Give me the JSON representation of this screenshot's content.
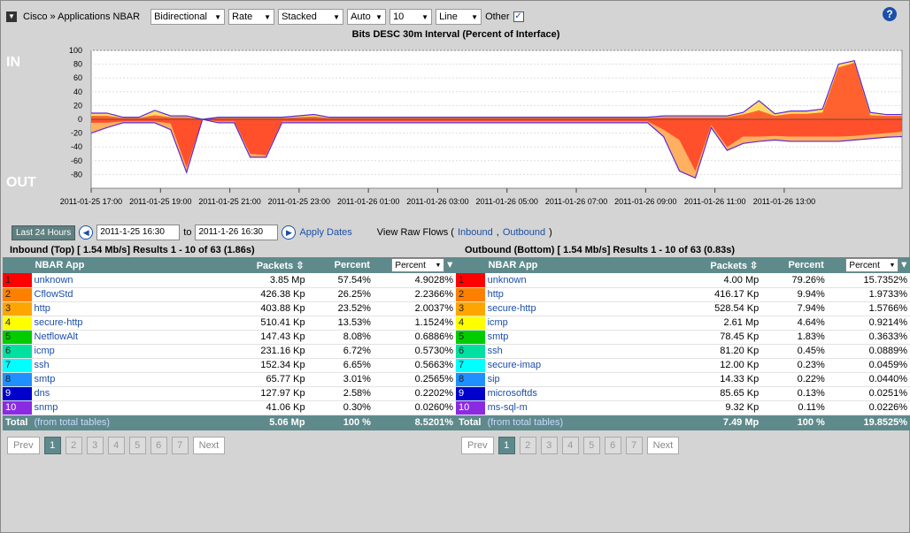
{
  "toolbar": {
    "title": "Cisco » Applications NBAR",
    "direction": "Bidirectional",
    "metric": "Rate",
    "style": "Stacked",
    "scale": "Auto",
    "top_n": "10",
    "chart_kind": "Line",
    "other_label": "Other",
    "other_checked": "✓"
  },
  "colors": {
    "series": [
      "#ff0000",
      "#ff7f00",
      "#ffa500",
      "#ffff00",
      "#00cc00",
      "#00e0a0",
      "#00ffff",
      "#1e90ff",
      "#0000cc",
      "#8a2be2"
    ]
  },
  "chart_data": {
    "type": "area",
    "title": "Bits DESC 30m Interval (Percent of Interface)",
    "in_label": "IN",
    "out_label": "OUT",
    "ylim": [
      -100,
      100
    ],
    "yticks": [
      "100",
      "80",
      "60",
      "40",
      "20",
      "0",
      "-20",
      "-40",
      "-60",
      "-80"
    ],
    "xticks": [
      "2011-01-25 17:00",
      "2011-01-25 19:00",
      "2011-01-25 21:00",
      "2011-01-25 23:00",
      "2011-01-26 01:00",
      "2011-01-26 03:00",
      "2011-01-26 05:00",
      "2011-01-26 07:00",
      "2011-01-26 09:00",
      "2011-01-26 11:00",
      "2011-01-26 13:00"
    ],
    "x": [
      0,
      1,
      2,
      3,
      4,
      5,
      6,
      7,
      8,
      9,
      10,
      11,
      12,
      13,
      14,
      15,
      16,
      17,
      18,
      19,
      20,
      21,
      22,
      23,
      24,
      25,
      26,
      27,
      28,
      29,
      30,
      31,
      32,
      33,
      34,
      35,
      36,
      37,
      38,
      39,
      40,
      41,
      42,
      43,
      44,
      45,
      46,
      47,
      48,
      49,
      50,
      51
    ],
    "inbound_total": [
      9,
      9,
      3,
      3,
      13,
      5,
      5,
      0,
      3,
      3,
      3,
      3,
      3,
      5,
      7,
      3,
      3,
      3,
      3,
      3,
      3,
      3,
      3,
      3,
      3,
      3,
      3,
      3,
      3,
      3,
      3,
      3,
      3,
      3,
      3,
      3,
      5,
      5,
      5,
      5,
      5,
      10,
      27,
      8,
      12,
      12,
      15,
      80,
      85,
      10,
      7,
      7
    ],
    "inbound_top": [
      5,
      5,
      2,
      2,
      6,
      3,
      3,
      0,
      2,
      2,
      2,
      2,
      2,
      3,
      4,
      2,
      2,
      2,
      2,
      2,
      2,
      2,
      2,
      2,
      2,
      2,
      2,
      2,
      2,
      2,
      2,
      2,
      2,
      2,
      2,
      2,
      3,
      3,
      3,
      3,
      3,
      7,
      13,
      5,
      8,
      8,
      10,
      75,
      82,
      6,
      5,
      5
    ],
    "outbound_total": [
      -20,
      -12,
      -5,
      -5,
      -5,
      -15,
      -77,
      0,
      -5,
      -5,
      -55,
      -55,
      -5,
      -5,
      -5,
      -5,
      -5,
      -5,
      -5,
      -5,
      -5,
      -5,
      -5,
      -5,
      -5,
      -5,
      -5,
      -5,
      -5,
      -5,
      -5,
      -5,
      -5,
      -5,
      -5,
      -5,
      -25,
      -75,
      -85,
      -12,
      -45,
      -35,
      -32,
      -30,
      -32,
      -32,
      -32,
      -32,
      -30,
      -28,
      -26,
      -25
    ],
    "outbound_top": [
      -5,
      -5,
      -3,
      -3,
      -3,
      -6,
      -70,
      0,
      -3,
      -3,
      -50,
      -52,
      -3,
      -3,
      -3,
      -3,
      -3,
      -3,
      -3,
      -3,
      -3,
      -3,
      -3,
      -3,
      -3,
      -3,
      -3,
      -3,
      -3,
      -3,
      -3,
      -3,
      -3,
      -3,
      -3,
      -3,
      -15,
      -30,
      -75,
      -8,
      -40,
      -25,
      -25,
      -24,
      -25,
      -25,
      -25,
      -25,
      -24,
      -22,
      -20,
      -18
    ]
  },
  "dates": {
    "range_button": "Last 24 Hours",
    "from": "2011-1-25 16:30",
    "to_label": "to",
    "to": "2011-1-26 16:30",
    "apply": "Apply Dates",
    "raw_flows_label": "View Raw Flows (",
    "inbound_link": "Inbound",
    "sep": ",",
    "outbound_link": "Outbound",
    "close": ")"
  },
  "inbound": {
    "title": "Inbound (Top) [ 1.54 Mb/s] Results 1 - 10 of 63 (1.86s)",
    "headers": {
      "app": "NBAR App",
      "packets": "Packets",
      "percent": "Percent",
      "pct_select": "Percent"
    },
    "rows": [
      {
        "rank": "1",
        "name": "unknown",
        "packets": "3.85 Mp",
        "percent": "57.54%",
        "pct2": "4.9028%"
      },
      {
        "rank": "2",
        "name": "CflowStd",
        "packets": "426.38 Kp",
        "percent": "26.25%",
        "pct2": "2.2366%"
      },
      {
        "rank": "3",
        "name": "http",
        "packets": "403.88 Kp",
        "percent": "23.52%",
        "pct2": "2.0037%"
      },
      {
        "rank": "4",
        "name": "secure-http",
        "packets": "510.41 Kp",
        "percent": "13.53%",
        "pct2": "1.1524%"
      },
      {
        "rank": "5",
        "name": "NetflowAlt",
        "packets": "147.43 Kp",
        "percent": "8.08%",
        "pct2": "0.6886%"
      },
      {
        "rank": "6",
        "name": "icmp",
        "packets": "231.16 Kp",
        "percent": "6.72%",
        "pct2": "0.5730%"
      },
      {
        "rank": "7",
        "name": "ssh",
        "packets": "152.34 Kp",
        "percent": "6.65%",
        "pct2": "0.5663%"
      },
      {
        "rank": "8",
        "name": "smtp",
        "packets": "65.77 Kp",
        "percent": "3.01%",
        "pct2": "0.2565%"
      },
      {
        "rank": "9",
        "name": "dns",
        "packets": "127.97 Kp",
        "percent": "2.58%",
        "pct2": "0.2202%"
      },
      {
        "rank": "10",
        "name": "snmp",
        "packets": "41.06 Kp",
        "percent": "0.30%",
        "pct2": "0.0260%"
      }
    ],
    "total": {
      "label": "Total",
      "link": "(from total tables)",
      "packets": "5.06 Mp",
      "percent": "100 %",
      "pct2": "8.5201%"
    }
  },
  "outbound": {
    "title": "Outbound (Bottom) [ 1.54 Mb/s] Results 1 - 10 of 63 (0.83s)",
    "headers": {
      "app": "NBAR App",
      "packets": "Packets",
      "percent": "Percent",
      "pct_select": "Percent"
    },
    "rows": [
      {
        "rank": "1",
        "name": "unknown",
        "packets": "4.00 Mp",
        "percent": "79.26%",
        "pct2": "15.7352%"
      },
      {
        "rank": "2",
        "name": "http",
        "packets": "416.17 Kp",
        "percent": "9.94%",
        "pct2": "1.9733%"
      },
      {
        "rank": "3",
        "name": "secure-http",
        "packets": "528.54 Kp",
        "percent": "7.94%",
        "pct2": "1.5766%"
      },
      {
        "rank": "4",
        "name": "icmp",
        "packets": "2.61 Mp",
        "percent": "4.64%",
        "pct2": "0.9214%"
      },
      {
        "rank": "5",
        "name": "smtp",
        "packets": "78.45 Kp",
        "percent": "1.83%",
        "pct2": "0.3633%"
      },
      {
        "rank": "6",
        "name": "ssh",
        "packets": "81.20 Kp",
        "percent": "0.45%",
        "pct2": "0.0889%"
      },
      {
        "rank": "7",
        "name": "secure-imap",
        "packets": "12.00 Kp",
        "percent": "0.23%",
        "pct2": "0.0459%"
      },
      {
        "rank": "8",
        "name": "sip",
        "packets": "14.33 Kp",
        "percent": "0.22%",
        "pct2": "0.0440%"
      },
      {
        "rank": "9",
        "name": "microsoftds",
        "packets": "85.65 Kp",
        "percent": "0.13%",
        "pct2": "0.0251%"
      },
      {
        "rank": "10",
        "name": "ms-sql-m",
        "packets": "9.32 Kp",
        "percent": "0.11%",
        "pct2": "0.0226%"
      }
    ],
    "total": {
      "label": "Total",
      "link": "(from total tables)",
      "packets": "7.49 Mp",
      "percent": "100 %",
      "pct2": "19.8525%"
    }
  },
  "pager": {
    "prev": "Prev",
    "pages": [
      "1",
      "2",
      "3",
      "4",
      "5",
      "6",
      "7"
    ],
    "next": "Next"
  }
}
